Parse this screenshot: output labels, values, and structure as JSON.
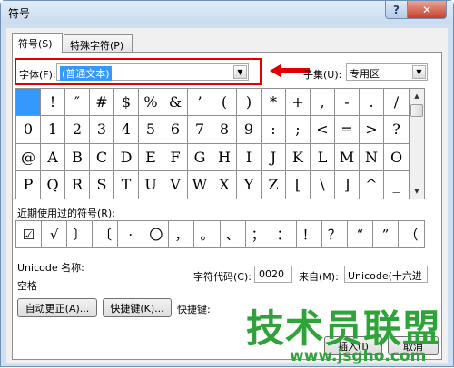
{
  "window": {
    "title": "符号",
    "help_glyph": "?",
    "close_glyph": "✕"
  },
  "tabs": [
    {
      "label": "符号(S)"
    },
    {
      "label": "特殊字符(P)"
    }
  ],
  "font": {
    "label": "字体(F):",
    "value": "(普通文本)"
  },
  "subset": {
    "label": "子集(U):",
    "value": "专用区"
  },
  "symbol_grid": [
    [
      "",
      "!",
      "″",
      "#",
      "$",
      "%",
      "&",
      "’",
      "(",
      ")",
      "*",
      "+",
      ",",
      "-",
      ".",
      "/"
    ],
    [
      "0",
      "1",
      "2",
      "3",
      "4",
      "5",
      "6",
      "7",
      "8",
      "9",
      ":",
      ";",
      "<",
      "=",
      ">",
      "?"
    ],
    [
      "@",
      "A",
      "B",
      "C",
      "D",
      "E",
      "F",
      "G",
      "H",
      "I",
      "J",
      "K",
      "L",
      "M",
      "N",
      "O"
    ],
    [
      "P",
      "Q",
      "R",
      "S",
      "T",
      "U",
      "V",
      "W",
      "X",
      "Y",
      "Z",
      "[",
      "\\",
      "]",
      "^",
      "_"
    ]
  ],
  "recent": {
    "label": "近期使用过的符号(R):",
    "symbols": [
      "☑",
      "√",
      "〕",
      "〔",
      "·",
      "〇",
      "，",
      "。",
      "、",
      "；",
      "：",
      "！",
      "？",
      "“",
      "”",
      "（"
    ]
  },
  "unicode_name": {
    "label": "Unicode 名称:",
    "value": "空格"
  },
  "char_code": {
    "label": "字符代码(C):",
    "value": "0020"
  },
  "from": {
    "label": "来自(M):",
    "value": "Unicode(十六进"
  },
  "buttons": {
    "autocorrect": "自动更正(A)...",
    "shortcut_key": "快捷键(K)...",
    "shortcut_label": "快捷键:",
    "insert": "插入(I)",
    "cancel": "取消"
  },
  "watermark": {
    "text": "技术员联盟",
    "url": "www.jsgho.com"
  },
  "colors": {
    "highlight": "#e00000",
    "selection": "#3399ff",
    "watermark": "#2fa33a"
  }
}
